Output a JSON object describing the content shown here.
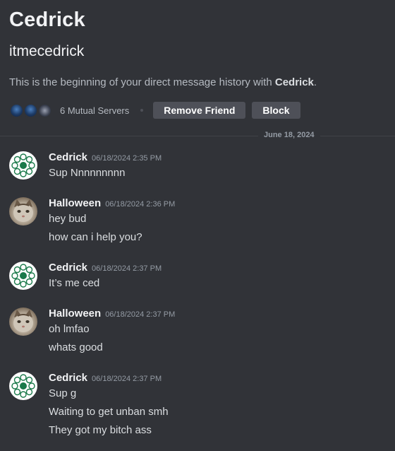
{
  "profile": {
    "display_name": "Cedrick",
    "username": "itmecedrick",
    "intro_prefix": "This is the beginning of your direct message history with ",
    "intro_name": "Cedrick",
    "intro_suffix": "."
  },
  "actions": {
    "mutual_servers": "6 Mutual Servers",
    "remove_friend": "Remove Friend",
    "block": "Block"
  },
  "divider": {
    "date": "June 18, 2024"
  },
  "messages": [
    {
      "author": "Cedrick",
      "timestamp": "06/18/2024 2:35 PM",
      "lines": [
        "Sup Nnnnnnnnn"
      ]
    },
    {
      "author": "Halloween",
      "timestamp": "06/18/2024 2:36 PM",
      "lines": [
        "hey bud",
        "how can i help you?"
      ]
    },
    {
      "author": "Cedrick",
      "timestamp": "06/18/2024 2:37 PM",
      "lines": [
        "It’s me ced"
      ]
    },
    {
      "author": "Halloween",
      "timestamp": "06/18/2024 2:37 PM",
      "lines": [
        "oh lmfao",
        "whats good"
      ]
    },
    {
      "author": "Cedrick",
      "timestamp": "06/18/2024 2:37 PM",
      "lines": [
        "Sup g",
        "Waiting to get unban smh",
        "They got my bitch ass"
      ]
    }
  ],
  "colors": {
    "background": "#313338",
    "button": "#4e5058",
    "avatar_green": "#1a7a4a"
  }
}
